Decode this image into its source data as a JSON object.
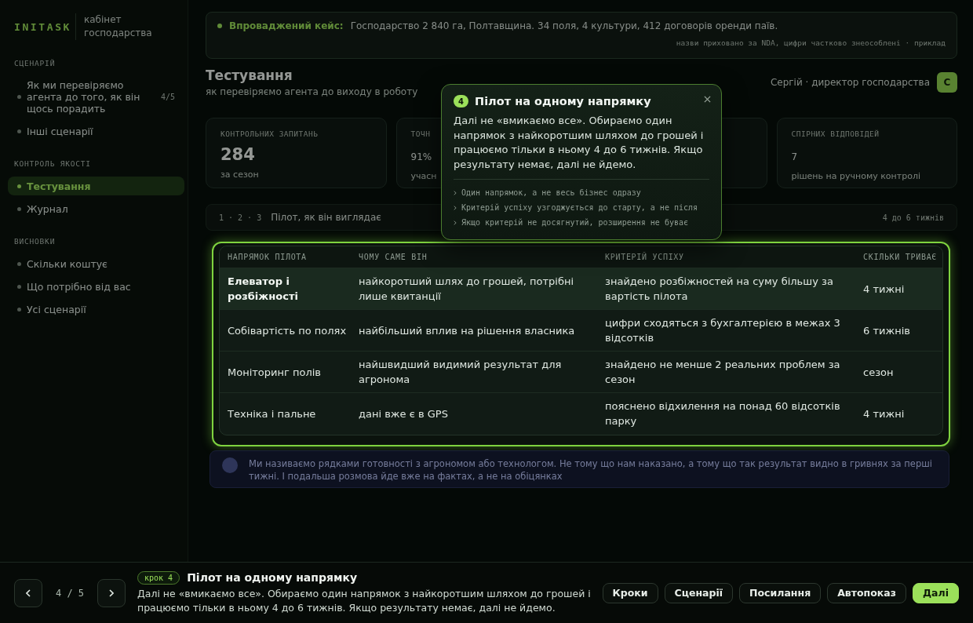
{
  "sidebar": {
    "logo": "INITASK",
    "subtitle": "кабінет господарства",
    "sections": [
      {
        "title": "СЦЕНАРІЙ",
        "items": [
          {
            "label": "Як ми перевіряємо агента до того, як він щось порадить",
            "count": "4/5",
            "selected": false
          },
          {
            "label": "Інші сценарії",
            "selected": false
          }
        ]
      },
      {
        "title": "КОНТРОЛЬ ЯКОСТІ",
        "items": [
          {
            "label": "Тестування",
            "selected": true
          },
          {
            "label": "Журнал",
            "selected": false
          }
        ]
      },
      {
        "title": "ВИСНОВКИ",
        "items": [
          {
            "label": "Скільки коштує",
            "selected": false
          },
          {
            "label": "Що потрібно від вас",
            "selected": false
          },
          {
            "label": "Усі сценарії",
            "selected": false
          }
        ]
      }
    ]
  },
  "banner": {
    "label": "Впроваджений кейс:",
    "text": "Господарство 2 840 га, Полтавщина. 34 поля, 4 культури, 412 договорів оренди паїв.",
    "note": "назви приховано за NDA, цифри частково знеособлені · приклад"
  },
  "header": {
    "title": "Тестування",
    "subtitle": "як перевіряємо агента до виходу в роботу",
    "user": "Сергій · директор господарства",
    "avatar": "С"
  },
  "stats": [
    {
      "kind": "headline",
      "label": "КОНТРОЛЬНИХ ЗАПИТАНЬ",
      "value": "284",
      "caption": "за сезон"
    },
    {
      "kind": "metric",
      "label": "ТОЧН",
      "value": "91%",
      "caption": "учасн"
    },
    {
      "kind": "covered"
    },
    {
      "kind": "metric",
      "label": "СПІРНИХ ВІДПОВІДЕЙ",
      "value": "7",
      "caption": "рішень на ручному контролі"
    }
  ],
  "section_bar": {
    "steps": "1 · 2 · 3",
    "title": "Пілот, як він виглядає",
    "duration": "4 до 6 тижнів"
  },
  "pilot_table": {
    "columns": [
      "НАПРЯМОК ПІЛОТА",
      "ЧОМУ САМЕ ВІН",
      "КРИТЕРІЙ УСПІХУ",
      "СКІЛЬКИ ТРИВАЄ"
    ],
    "rows": [
      {
        "direction": "Елеватор і розбіжності",
        "reason": "найкоротший шлях до грошей, потрібні лише квитанції",
        "criterion": "знайдено розбіжностей на суму більшу за вартість пілота",
        "duration": "4 тижні",
        "selected": true
      },
      {
        "direction": "Собівартість по полях",
        "reason": "найбільший вплив на рішення власника",
        "criterion": "цифри сходяться з бухгалтерією в межах 3 відсотків",
        "duration": "6 тижнів",
        "selected": false
      },
      {
        "direction": "Моніторинг полів",
        "reason": "найшвидший видимий результат для агронома",
        "criterion": "знайдено не менше 2 реальних проблем за сезон",
        "duration": "сезон",
        "selected": false
      },
      {
        "direction": "Техніка і пальне",
        "reason": "дані вже є в GPS",
        "criterion": "пояснено відхилення на понад 60 відсотків парку",
        "duration": "4 тижні",
        "selected": false
      }
    ]
  },
  "note": {
    "text": "Ми називаємо рядками готовності з агрономом або технологом. Не тому що нам наказано, а тому що так результат видно в гривнях за перші тижні. І подальша розмова йде вже на фактах, а не на обіцянках"
  },
  "tooltip": {
    "step": "4",
    "title": "Пілот на одному напрямку",
    "text": "Далі не «вмикаємо все». Обираємо один напрямок з найкоротшим шляхом до грошей і працюємо тільки в ньому 4 до 6 тижнів. Якщо результату немає, далі не йдемо.",
    "points": [
      "Один напрямок, а не весь бізнес одразу",
      "Критерій успіху узгоджується до старту, а не після",
      "Якщо критерій не досягнутий, розширення не буває"
    ]
  },
  "tour_bar": {
    "counter": "4 / 5",
    "badge": "крок 4",
    "title": "Пілот на одному напрямку",
    "text": "Далі не «вмикаємо все». Обираємо один напрямок з найкоротшим шляхом до грошей і працюємо тільки в ньому 4 до 6 тижнів. Якщо результату немає, далі не йдемо.",
    "buttons": [
      {
        "label": "Кроки",
        "kind": "secondary"
      },
      {
        "label": "Сценарії",
        "kind": "secondary"
      },
      {
        "label": "Посилання",
        "kind": "secondary"
      },
      {
        "label": "Автопоказ",
        "kind": "secondary"
      },
      {
        "label": "Далі",
        "kind": "primary"
      }
    ]
  }
}
